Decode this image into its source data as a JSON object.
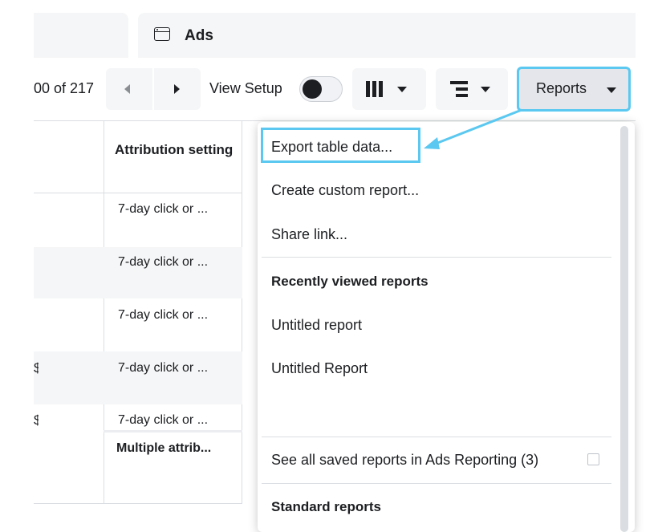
{
  "tabs": {
    "ads_label": "Ads"
  },
  "toolbar": {
    "pager_text": "00 of 217",
    "view_setup_label": "View Setup",
    "reports_label": "Reports"
  },
  "table": {
    "attribution_header": "Attribution setting",
    "rows": [
      {
        "attribution": "7-day click or ..."
      },
      {
        "attribution": "7-day click or ..."
      },
      {
        "attribution": "7-day click or ..."
      },
      {
        "attribution": "7-day click or ..."
      },
      {
        "attribution": "7-day click or ..."
      }
    ],
    "summary_attribution": "Multiple attrib...",
    "truncated_cell": "$"
  },
  "reports_menu": {
    "items": [
      {
        "label": "Export table data..."
      },
      {
        "label": "Create custom report..."
      },
      {
        "label": "Share link..."
      }
    ],
    "recently_viewed_heading": "Recently viewed reports",
    "recent_reports": [
      {
        "label": "Untitled report"
      },
      {
        "label": "Untitled Report"
      }
    ],
    "see_all_label": "See all saved reports in Ads Reporting (3)",
    "standard_heading": "Standard reports"
  },
  "colors": {
    "highlight": "#5ac8f0",
    "toolbar_bg": "#f5f6f7"
  },
  "icons": [
    "window-icon",
    "chevron-left-icon",
    "chevron-right-icon",
    "columns-icon",
    "breakdown-icon",
    "caret-down-icon",
    "external-link-icon"
  ]
}
